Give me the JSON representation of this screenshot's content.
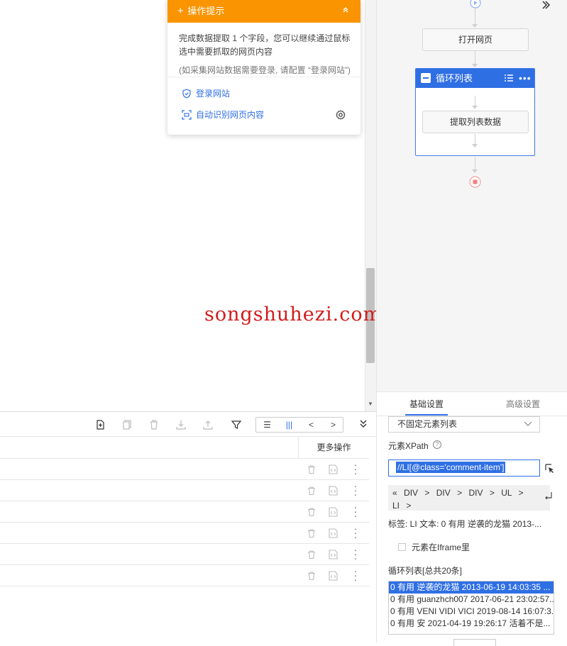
{
  "tip": {
    "title": "操作提示",
    "plus": "+",
    "text": "完成数据提取 1 个字段，您可以继续通过鼠标选中需要抓取的网页内容",
    "note": "(如采集网站数据需要登录, 请配置 “登录网站”)",
    "login_link": "登录网站",
    "auto_link": "自动识别网页内容"
  },
  "watermark": "songshuhezi.com",
  "toolbar": {
    "group": [
      "☰",
      "|||",
      "<",
      ">"
    ]
  },
  "table": {
    "more_ops": "更多操作",
    "row_count": 6
  },
  "flow": {
    "open_page": "打开网页",
    "loop_title": "循环列表",
    "extract": "提取列表数据"
  },
  "settings": {
    "tab_basic": "基础设置",
    "tab_advanced": "高级设置",
    "select_value": "不固定元素列表",
    "xpath_label": "元素XPath",
    "xpath_help": "?",
    "xpath_value": "//LI[@class='comment-item']",
    "crumbs": [
      "DIV",
      "DIV",
      "DIV",
      "UL",
      "LI"
    ],
    "tag_info": "标签:  LI  文本:  0 有用 逆袭的龙猫 2013-...",
    "iframe_label": "元素在Iframe里",
    "loop_list_label": "循环列表[总共20条]",
    "loop_items": [
      "0 有用 逆袭的龙猫 2013-06-19 14:03:35 ...",
      "0 有用 guanzhch007 2017-06-21 23:02:57...",
      "0 有用 VENI VIDI VICI 2019-08-14 16:07:3...",
      "0 有用 安 2021-04-19 19:26:17 活着不是..."
    ]
  },
  "colors": {
    "accent": "#2f6fe4",
    "tip_header": "#fa9400",
    "watermark": "#d21c1c"
  }
}
